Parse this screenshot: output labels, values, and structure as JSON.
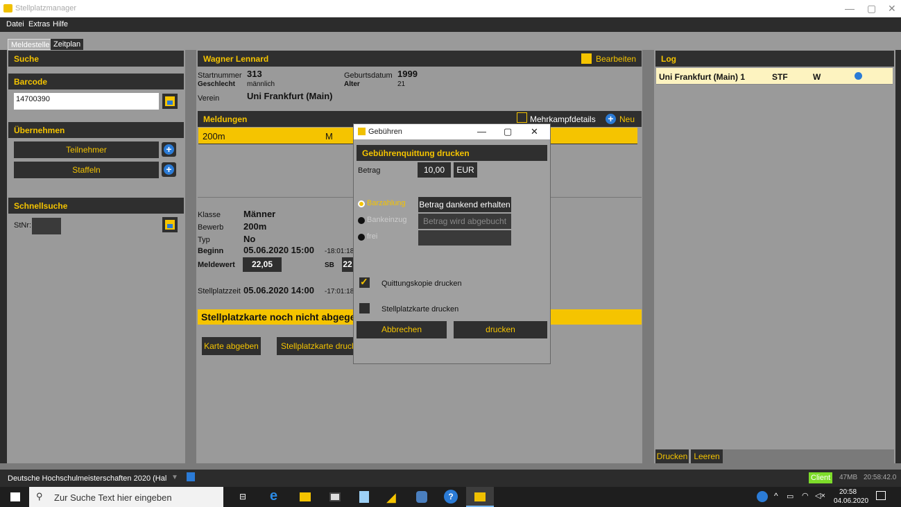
{
  "window": {
    "title": "Stellplatzmanager",
    "min": "—",
    "max": "▢",
    "close": "✕"
  },
  "menu": [
    "Datei",
    "Extras",
    "Hilfe"
  ],
  "tabs": [
    "Meldestelle",
    "Zeitplan"
  ],
  "left": {
    "suche": "Suche",
    "barcode": "Barcode",
    "barcode_value": "14700390",
    "uebernehmen": "Übernehmen",
    "teilnehmer": "Teilnehmer",
    "staffeln": "Staffeln",
    "schnellsuche": "Schnellsuche",
    "stnr": "StNr:"
  },
  "athlete": {
    "name": "Wagner Lennard",
    "edit": "Bearbeiten",
    "startnummer_label": "Startnummer",
    "startnummer": "313",
    "geschlecht_label": "Geschlecht",
    "geschlecht": "männlich",
    "geburtsdatum_label": "Geburtsdatum",
    "geburtsdatum": "1999",
    "alter_label": "Alter",
    "alter": "21",
    "verein_label": "Verein",
    "verein": "Uni Frankfurt (Main)"
  },
  "meldungen": {
    "title": "Meldungen",
    "mehrkampf": "Mehrkampfdetails",
    "neu": "Neu",
    "row_event": "200m",
    "row_sex": "M"
  },
  "details": {
    "klasse_label": "Klasse",
    "klasse": "Männer",
    "bewerb_label": "Bewerb",
    "bewerb": "200m",
    "typ_label": "Typ",
    "typ": "No",
    "beginn_label": "Beginn",
    "beginn": "05.06.2020 15:00",
    "beginn_rel": "-18:01:18",
    "meldewert_label": "Meldewert",
    "meldewert": "22,05",
    "sb_label": "SB",
    "sb": "22",
    "stellplatz_label": "Stellplatzzeit",
    "stellplatz": "05.06.2020 14:00",
    "stellplatz_rel": "-17:01:18",
    "banner": "Stellplatzkarte noch nicht abgegeben",
    "karte_abgeben": "Karte abgeben",
    "stellplatzkarte_drucken": "Stellplatzkarte drucken"
  },
  "log": {
    "title": "Log",
    "club": "Uni Frankfurt (Main) 1",
    "code": "STF",
    "sex": "W",
    "drucken": "Drucken",
    "leeren": "Leeren"
  },
  "dialog": {
    "title": "Gebühren",
    "header": "Gebührenquittung drucken",
    "betrag_label": "Betrag",
    "betrag": "10,00",
    "currency": "EUR",
    "barzahlung": "Barzahlung",
    "barzahlung_btn": "Betrag dankend erhalten",
    "bankeinzug": "Bankeinzug",
    "bankeinzug_btn": "Betrag wird abgebucht",
    "frei": "frei",
    "quittungskopie": "Quittungskopie drucken",
    "stellplatzkarte": "Stellplatzkarte drucken",
    "abbrechen": "Abbrechen",
    "drucken": "drucken"
  },
  "status": {
    "event": "Deutsche Hochschulmeisterschaften 2020 (Hal",
    "client": "Client",
    "mem": "47MB",
    "time": "20:58:42.0"
  },
  "taskbar": {
    "search": "Zur Suche Text hier eingeben",
    "clock_time": "20:58",
    "clock_date": "04.06.2020"
  }
}
